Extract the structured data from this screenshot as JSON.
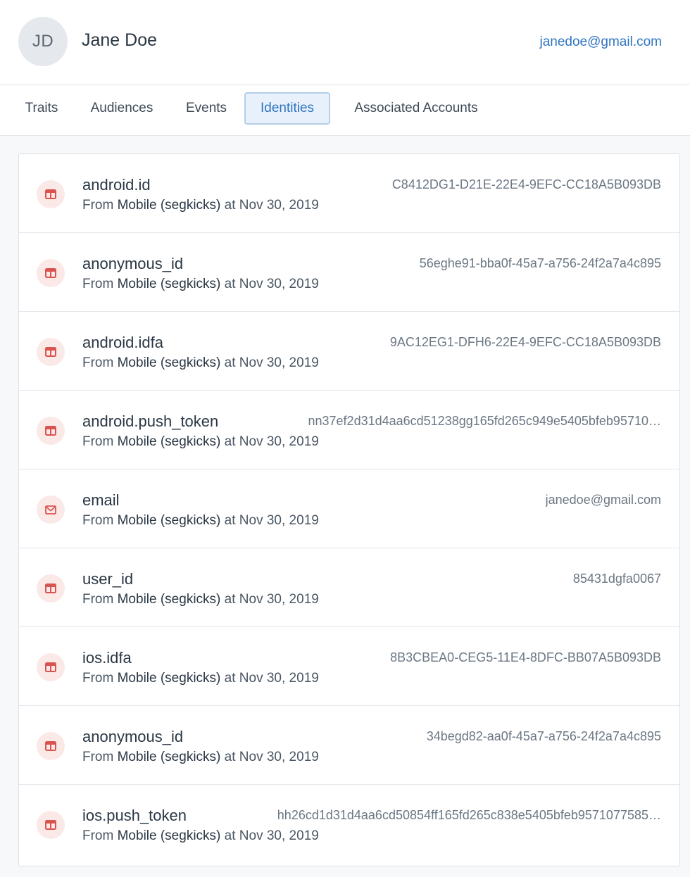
{
  "profile": {
    "initials": "JD",
    "name": "Jane Doe",
    "email": "janedoe@gmail.com"
  },
  "tabs": [
    {
      "label": "Traits",
      "active": false
    },
    {
      "label": "Audiences",
      "active": false
    },
    {
      "label": "Events",
      "active": false
    },
    {
      "label": "Identities",
      "active": true
    },
    {
      "label": "Associated Accounts",
      "active": false
    }
  ],
  "source_text": {
    "prefix": "From",
    "source": "Mobile (segkicks)",
    "connector": "at",
    "date": "Nov 30, 2019"
  },
  "identities": [
    {
      "key": "android.id",
      "value": "C8412DG1-D21E-22E4-9EFC-CC18A5B093DB",
      "icon": "table-icon"
    },
    {
      "key": "anonymous_id",
      "value": "56eghe91-bba0f-45a7-a756-24f2a7a4c895",
      "icon": "table-icon"
    },
    {
      "key": "android.idfa",
      "value": "9AC12EG1-DFH6-22E4-9EFC-CC18A5B093DB",
      "icon": "table-icon"
    },
    {
      "key": "android.push_token",
      "value": "nn37ef2d31d4aa6cd51238gg165fd265c949e5405bfeb95710…",
      "icon": "table-icon"
    },
    {
      "key": "email",
      "value": "janedoe@gmail.com",
      "icon": "mail-icon"
    },
    {
      "key": "user_id",
      "value": "85431dgfa0067",
      "icon": "table-icon"
    },
    {
      "key": "ios.idfa",
      "value": "8B3CBEA0-CEG5-11E4-8DFC-BB07A5B093DB",
      "icon": "table-icon"
    },
    {
      "key": "anonymous_id",
      "value": "34begd82-aa0f-45a7-a756-24f2a7a4c895",
      "icon": "table-icon"
    },
    {
      "key": "ios.push_token",
      "value": "hh26cd1d31d4aa6cd50854ff165fd265c838e5405bfeb9571077585…",
      "icon": "table-icon"
    }
  ],
  "colors": {
    "accent": "#2f74c0",
    "icon_red": "#d9534f",
    "icon_bg": "#fbe9e8"
  }
}
